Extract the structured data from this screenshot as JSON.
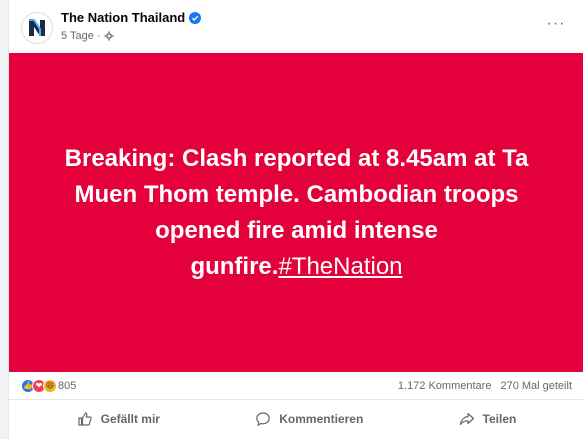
{
  "post": {
    "page_name": "The Nation Thailand",
    "time": "5 Tage",
    "separator": "·",
    "avatar_letter": "N",
    "more_label": "···"
  },
  "media": {
    "text": "Breaking: Clash reported at 8.45am at Ta Muen Thom temple. Cambodian troops opened fire amid intense gunfire.",
    "hashtag": "#TheNation",
    "background": "#e4003a"
  },
  "stats": {
    "reaction_count": "805",
    "comments": "1.172 Kommentare",
    "shares": "270 Mal geteilt"
  },
  "actions": {
    "like": "Gefällt mir",
    "comment": "Kommentieren",
    "share": "Teilen"
  },
  "colors": {
    "accent": "#1877f2",
    "muted_text": "#65676b"
  }
}
